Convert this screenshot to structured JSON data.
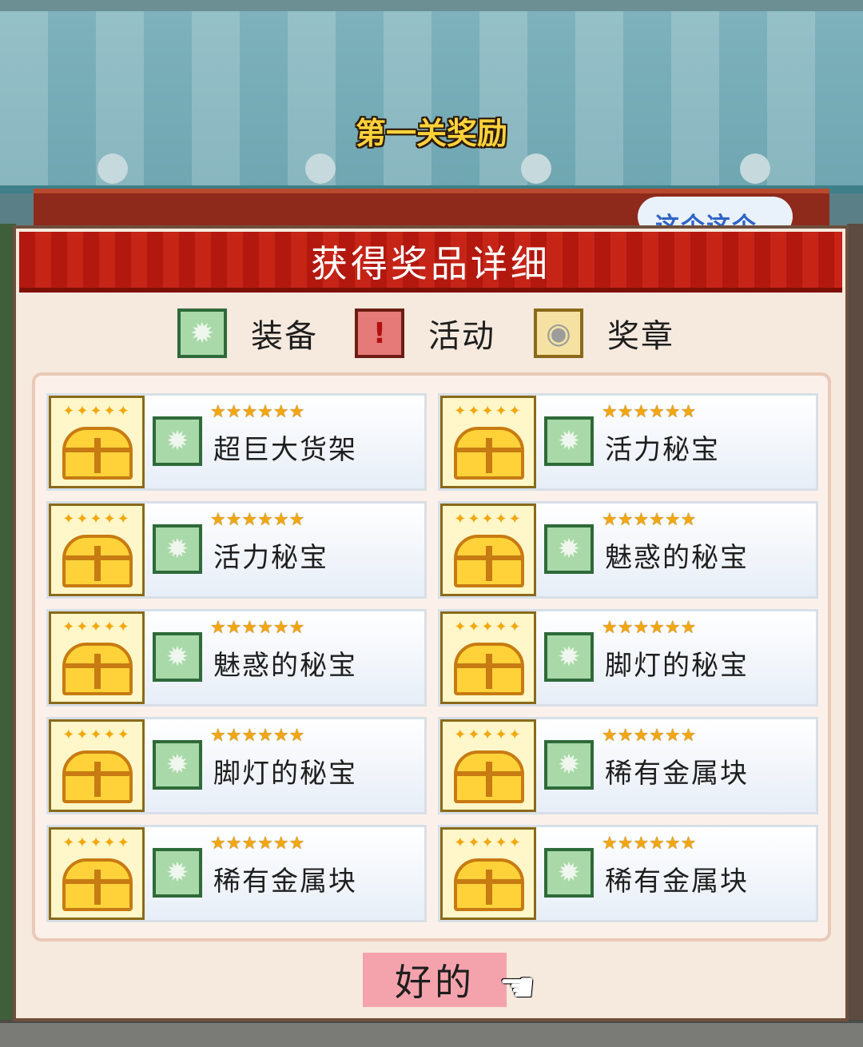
{
  "level_reward_title": "第一关奖励",
  "background_sign_partial": "这个这个",
  "dialog": {
    "title": "获得奖品详细",
    "legend": [
      {
        "icon": "gear-icon",
        "label": "装备"
      },
      {
        "icon": "exclamation-icon",
        "label": "活动"
      },
      {
        "icon": "medal-icon",
        "label": "奖章"
      }
    ],
    "rewards": [
      {
        "name": "超巨大货架",
        "stars": 6,
        "icon": "gear-icon"
      },
      {
        "name": "活力秘宝",
        "stars": 6,
        "icon": "gear-icon"
      },
      {
        "name": "活力秘宝",
        "stars": 6,
        "icon": "gear-icon"
      },
      {
        "name": "魅惑的秘宝",
        "stars": 6,
        "icon": "gear-icon"
      },
      {
        "name": "魅惑的秘宝",
        "stars": 6,
        "icon": "gear-icon"
      },
      {
        "name": "脚灯的秘宝",
        "stars": 6,
        "icon": "gear-icon"
      },
      {
        "name": "脚灯的秘宝",
        "stars": 6,
        "icon": "gear-icon"
      },
      {
        "name": "稀有金属块",
        "stars": 6,
        "icon": "gear-icon"
      },
      {
        "name": "稀有金属块",
        "stars": 6,
        "icon": "gear-icon"
      },
      {
        "name": "稀有金属块",
        "stars": 6,
        "icon": "gear-icon"
      }
    ],
    "ok_button_label": "好的"
  },
  "colors": {
    "header_red": "#b3180f",
    "panel_bg": "#f6e9de",
    "ok_button_bg": "#f4a3ad",
    "title_gold": "#ffd23a"
  }
}
